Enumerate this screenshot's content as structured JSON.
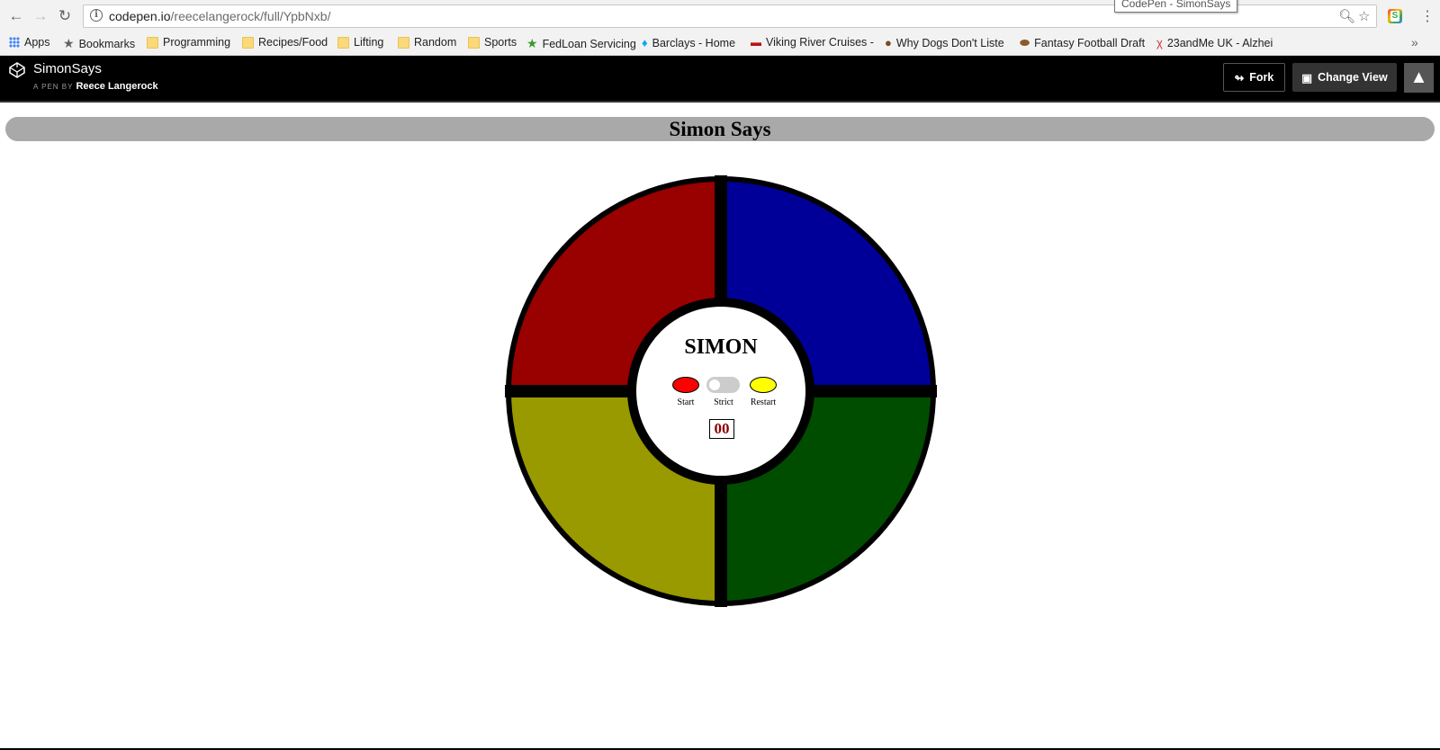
{
  "browser": {
    "url_host": "codepen.io",
    "url_path": "/reecelangerock/full/YpbNxb/",
    "tooltip": "CodePen - SimonSays",
    "bookmarks": [
      {
        "label": "Apps",
        "icon": "apps-icon"
      },
      {
        "label": "Bookmarks",
        "icon": "star-icon"
      },
      {
        "label": "Programming",
        "icon": "folder-icon"
      },
      {
        "label": "Recipes/Food",
        "icon": "folder-icon"
      },
      {
        "label": "Lifting",
        "icon": "folder-icon"
      },
      {
        "label": "Random",
        "icon": "folder-icon"
      },
      {
        "label": "Sports",
        "icon": "folder-icon"
      },
      {
        "label": "FedLoan Servicing",
        "icon": "fedloan-icon"
      },
      {
        "label": "Barclays - Home",
        "icon": "barclays-icon"
      },
      {
        "label": "Viking River Cruises -",
        "icon": "viking-icon"
      },
      {
        "label": "Why Dogs Don't Liste",
        "icon": "paw-icon"
      },
      {
        "label": "Fantasy Football Draft",
        "icon": "football-icon"
      },
      {
        "label": "23andMe UK - Alzhei",
        "icon": "dna-icon"
      }
    ]
  },
  "codepen": {
    "pen_title": "SimonSays",
    "by_prefix": "A PEN BY",
    "author": "Reece Langerock",
    "fork_label": "Fork",
    "change_view_label": "Change View"
  },
  "page": {
    "title": "Simon Says"
  },
  "game": {
    "label": "SIMON",
    "start_label": "Start",
    "strict_label": "Strict",
    "restart_label": "Restart",
    "count": "00",
    "strict_on": false,
    "colors": {
      "red": "#990000",
      "blue": "#000099",
      "yellow": "#999900",
      "green": "#004d00",
      "start": "#ff0000",
      "restart": "#ffff00"
    }
  }
}
